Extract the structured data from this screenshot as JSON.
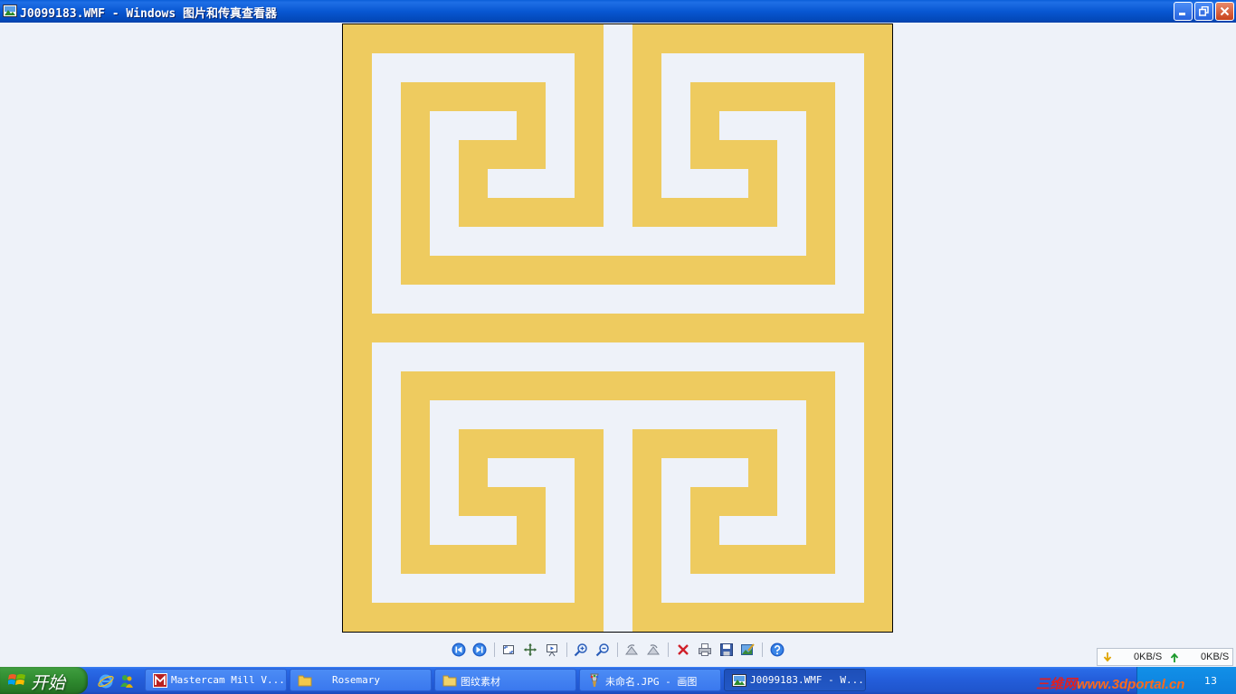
{
  "window": {
    "title": "J0099183.WMF - Windows 图片和传真查看器",
    "controls": [
      "minimize",
      "restore",
      "close"
    ]
  },
  "image": {
    "pattern_color": "#eecb5f",
    "background_color": "#eef2f9",
    "frame_color": "#000000"
  },
  "toolbar": {
    "buttons": [
      {
        "id": "prev",
        "icon": "previous-image-icon"
      },
      {
        "id": "next",
        "icon": "next-image-icon"
      },
      {
        "id": "best-fit",
        "icon": "best-fit-icon"
      },
      {
        "id": "actual-size",
        "icon": "actual-size-icon"
      },
      {
        "id": "slideshow",
        "icon": "slideshow-icon"
      },
      {
        "id": "zoom-in",
        "icon": "zoom-in-icon"
      },
      {
        "id": "zoom-out",
        "icon": "zoom-out-icon"
      },
      {
        "id": "rotate-cw",
        "icon": "rotate-clockwise-icon"
      },
      {
        "id": "rotate-ccw",
        "icon": "rotate-counterclockwise-icon"
      },
      {
        "id": "delete",
        "icon": "delete-icon"
      },
      {
        "id": "print",
        "icon": "print-icon"
      },
      {
        "id": "save",
        "icon": "save-icon"
      },
      {
        "id": "edit",
        "icon": "edit-image-icon"
      },
      {
        "id": "help",
        "icon": "help-icon"
      }
    ]
  },
  "speed": {
    "download": "0KB/S",
    "upload": "0KB/S"
  },
  "taskbar": {
    "start_label": "开始",
    "quick_launch": [
      "internet-explorer-icon",
      "messenger-icon"
    ],
    "tasks": [
      {
        "label": "Mastercam Mill V...",
        "icon": "mastercam-icon",
        "active": false
      },
      {
        "label": "Rosemary",
        "icon": "folder-icon",
        "active": false
      },
      {
        "label": "图纹素材",
        "icon": "folder-icon",
        "active": false
      },
      {
        "label": "未命名.JPG - 画图",
        "icon": "paint-icon",
        "active": false
      },
      {
        "label": "J0099183.WMF - W...",
        "icon": "image-viewer-icon",
        "active": true
      }
    ],
    "clock": "13"
  },
  "watermark": {
    "text_cn": "三维网",
    "text_url": "www.3dportal.cn"
  }
}
